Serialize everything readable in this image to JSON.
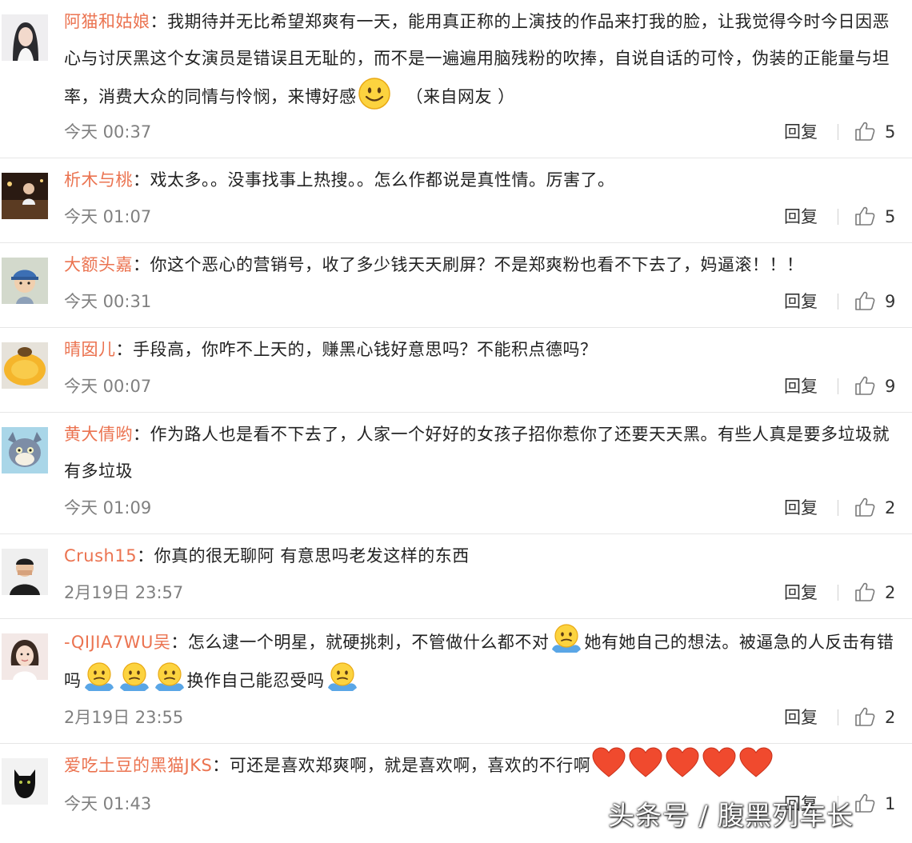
{
  "colors": {
    "username": "#eb7350",
    "timestamp": "#808080",
    "divider": "#e6e6e6"
  },
  "reply_label": "回复",
  "like_icon": "thumbs-up-icon",
  "watermark": "头条号 / 腹黑列车长",
  "comments": [
    {
      "username": "阿猫和姑娘",
      "separator": "：",
      "text_before_emoji": "我期待并无比希望郑爽有一天，能用真正称的上演技的作品来打我的脸，让我觉得今时今日因恶心与讨厌黑这个女演员是错误且无耻的，而不是一遍遍用脑残粉的吹捧，自说自话的可怜，伪装的正能量与坦率，消费大众的同情与怜悯，来博好感",
      "emoji": "smile-emoji",
      "text_after_emoji": "（来自网友 ）",
      "timestamp": "今天 00:37",
      "likes": "5"
    },
    {
      "username": "析木与桃",
      "separator": "：",
      "text": "戏太多。。没事找事上热搜。。怎么作都说是真性情。厉害了。",
      "timestamp": "今天 01:07",
      "likes": "5"
    },
    {
      "username": "大额头嘉",
      "separator": "：",
      "text": "你这个恶心的营销号，收了多少钱天天刷屏？不是郑爽粉也看不下去了，妈逼滚！！！",
      "timestamp": "今天 00:31",
      "likes": "9"
    },
    {
      "username": "晴囡儿",
      "separator": "：",
      "text": "手段高，你咋不上天的，赚黑心钱好意思吗？不能积点德吗？",
      "timestamp": "今天 00:07",
      "likes": "9"
    },
    {
      "username": "黄大倩哟",
      "separator": "：",
      "text": "作为路人也是看不下去了，人家一个好好的女孩子招你惹你了还要天天黑。有些人真是要多垃圾就有多垃圾",
      "timestamp": "今天 01:09",
      "likes": "2"
    },
    {
      "username": "Crush15",
      "separator": "：",
      "text": "你真的很无聊阿 有意思吗老发这样的东西",
      "timestamp": "2月19日 23:57",
      "likes": "2"
    },
    {
      "username": "-QIJIA7WU吴",
      "separator": "：",
      "text_part1": "怎么逮一个明星，就硬挑刺，不管做什么都不对",
      "text_part2": "她有她自己的想法。被逼急的人反击有错吗",
      "text_part3": "换作自己能忍受吗",
      "emoji": "shrug-emoji",
      "timestamp": "2月19日 23:55",
      "likes": "2"
    },
    {
      "username": "爱吃土豆的黑猫JKS",
      "separator": "：",
      "text": "可还是喜欢郑爽啊，就是喜欢啊，喜欢的不行啊",
      "emoji": "heart-emoji",
      "timestamp": "今天 01:43",
      "likes": "1"
    }
  ]
}
